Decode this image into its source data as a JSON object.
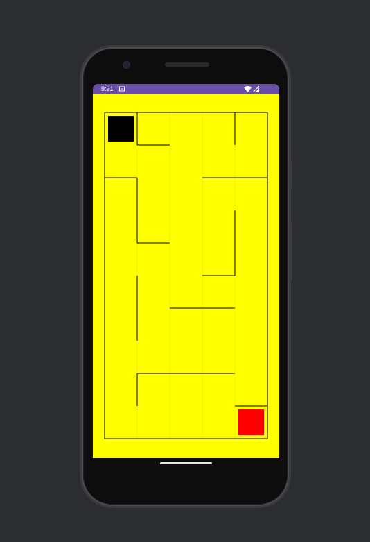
{
  "status_bar": {
    "time": "9:21",
    "notification_icon": "sync-icon",
    "wifi_icon": "wifi-icon",
    "signal_icon": "signal-icon",
    "color": "#6a4fa8"
  },
  "game": {
    "background_color": "#ffff00",
    "wall_color": "#000000",
    "player_color": "#000000",
    "exit_color": "#ff0000",
    "maze_columns": 5,
    "maze_rows": 10,
    "player_cell": {
      "col": 0,
      "row": 0
    },
    "exit_cell": {
      "col": 4,
      "row": 9
    }
  }
}
